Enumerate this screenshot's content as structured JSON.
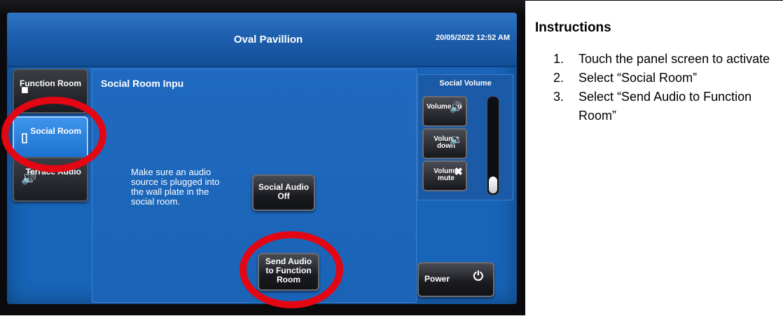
{
  "panel": {
    "title": "Oval Pavillion",
    "datetime": "20/05/2022 12:52 AM",
    "content_title": "Social Room Inpu",
    "info_text": "Make sure an audio source is plugged into the wall plate in the social room.",
    "nav": [
      {
        "label": "Function Room",
        "icon": "speaker-icon",
        "active": false
      },
      {
        "label": "Social Room",
        "icon": "ipod-icon",
        "active": true
      },
      {
        "label": "Terrace Audio",
        "icon": "speaker-icon",
        "active": false
      }
    ],
    "buttons": {
      "social_audio_off": "Social Audio Off",
      "send_audio": "Send Audio to Function Room",
      "power": "Power"
    },
    "volume": {
      "title": "Social Volume",
      "up": "Volume up",
      "down": "Volume down",
      "mute": "Volume mute",
      "level_fraction": 0.18
    },
    "annotation_color": "#e30613"
  },
  "instructions": {
    "title": "Instructions",
    "steps": [
      {
        "num": "1.",
        "text": "Touch the panel screen to activate"
      },
      {
        "num": "2.",
        "text": "Select “Social Room”"
      },
      {
        "num": "3.",
        "text": "Select “Send Audio to Function Room”"
      }
    ]
  }
}
